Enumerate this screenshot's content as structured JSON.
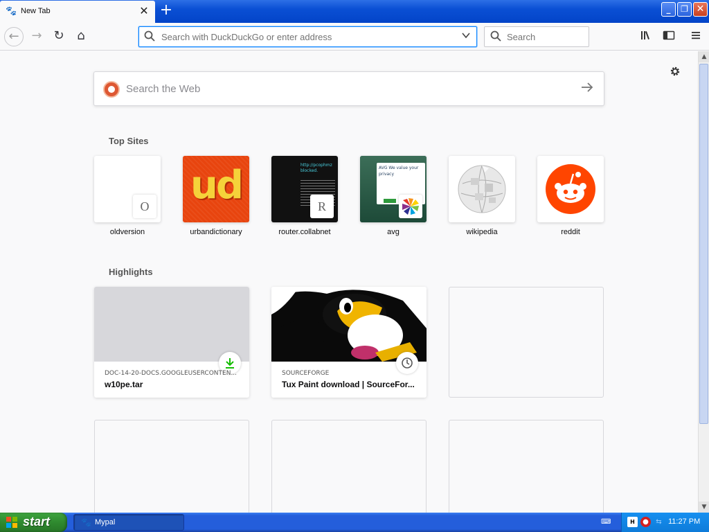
{
  "browser": {
    "tab": {
      "title": "New Tab",
      "favicon": "mypal-icon",
      "close_glyph": "✕"
    },
    "new_tab_glyph": "+",
    "window_buttons": {
      "minimize": "_",
      "restore": "❐",
      "close": "✕"
    }
  },
  "toolbar": {
    "back_glyph": "←",
    "forward_glyph": "→",
    "reload_glyph": "↻",
    "home_glyph": "⌂",
    "url_placeholder": "Search with DuckDuckGo or enter address",
    "search_placeholder": "Search",
    "library_glyph": "⫼",
    "sidebar_glyph": "◧",
    "menu_glyph": "≡"
  },
  "newtab": {
    "web_search_placeholder": "Search the Web",
    "top_sites_title": "Top Sites",
    "highlights_title": "Highlights",
    "top_sites": [
      {
        "label": "oldversion",
        "badge": "O"
      },
      {
        "label": "urbandictionary",
        "logo_text": "ud"
      },
      {
        "label": "router.collabnet",
        "badge": "R",
        "screenshot_text": "http://pcophmz blocked."
      },
      {
        "label": "avg",
        "screenshot_text": "AVG We value your privacy"
      },
      {
        "label": "wikipedia"
      },
      {
        "label": "reddit"
      }
    ],
    "highlights": [
      {
        "context": "DOC-14-20-DOCS.GOOGLEUSERCONTEN...",
        "title": "w10pe.tar",
        "indicator": "download-icon"
      },
      {
        "context": "SOURCEFORGE",
        "title": "Tux Paint download | SourceFor...",
        "indicator": "clock-icon"
      }
    ]
  },
  "taskbar": {
    "start_label": "start",
    "task_label": "Mypal",
    "clock": "11:27 PM"
  },
  "colors": {
    "xp_blue": "#245edb",
    "start_green": "#2f8a2f",
    "accent": "#0a84ff",
    "reddit": "#ff4500",
    "urbandictionary": "#e8440e"
  }
}
